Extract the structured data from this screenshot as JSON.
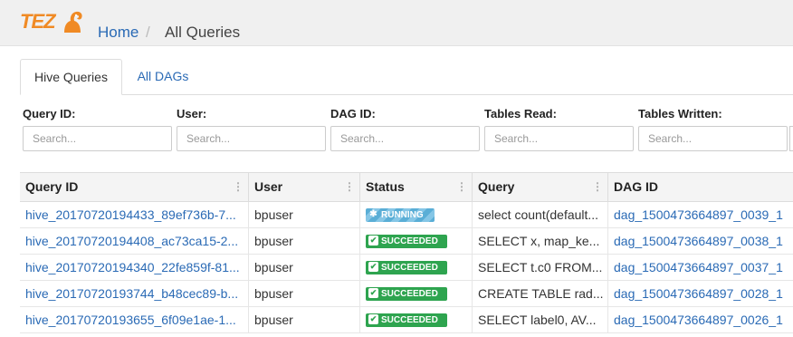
{
  "app": {
    "logo_text": "TEZ",
    "logo_icon": "tez-camel-icon",
    "brand_color": "#f08a24"
  },
  "breadcrumb": {
    "home": "Home",
    "separator": "/",
    "current": "All Queries"
  },
  "tabs": [
    {
      "label": "Hive Queries",
      "active": true
    },
    {
      "label": "All DAGs",
      "active": false
    }
  ],
  "filters": [
    {
      "label": "Query ID:",
      "placeholder": "Search..."
    },
    {
      "label": "User:",
      "placeholder": "Search..."
    },
    {
      "label": "DAG ID:",
      "placeholder": "Search..."
    },
    {
      "label": "Tables Read:",
      "placeholder": "Search..."
    },
    {
      "label": "Tables Written:",
      "placeholder": "Search..."
    }
  ],
  "table": {
    "columns": [
      "Query ID",
      "User",
      "Status",
      "Query",
      "DAG ID"
    ],
    "rows": [
      {
        "query_id": "hive_20170720194433_89ef736b-7...",
        "user": "bpuser",
        "status": "RUNNING",
        "query": "select count(default...",
        "dag_id": "dag_1500473664897_0039_1"
      },
      {
        "query_id": "hive_20170720194408_ac73ca15-2...",
        "user": "bpuser",
        "status": "SUCCEEDED",
        "query": "SELECT x, map_ke...",
        "dag_id": "dag_1500473664897_0038_1"
      },
      {
        "query_id": "hive_20170720194340_22fe859f-81...",
        "user": "bpuser",
        "status": "SUCCEEDED",
        "query": "SELECT t.c0 FROM...",
        "dag_id": "dag_1500473664897_0037_1"
      },
      {
        "query_id": "hive_20170720193744_b48cec89-b...",
        "user": "bpuser",
        "status": "SUCCEEDED",
        "query": "CREATE TABLE rad...",
        "dag_id": "dag_1500473664897_0028_1"
      },
      {
        "query_id": "hive_20170720193655_6f09e1ae-1...",
        "user": "bpuser",
        "status": "SUCCEEDED",
        "query": "SELECT label0, AV...",
        "dag_id": "dag_1500473664897_0026_1"
      }
    ]
  },
  "status_colors": {
    "SUCCEEDED": "#2ea44f",
    "RUNNING": "#5aaed6"
  }
}
